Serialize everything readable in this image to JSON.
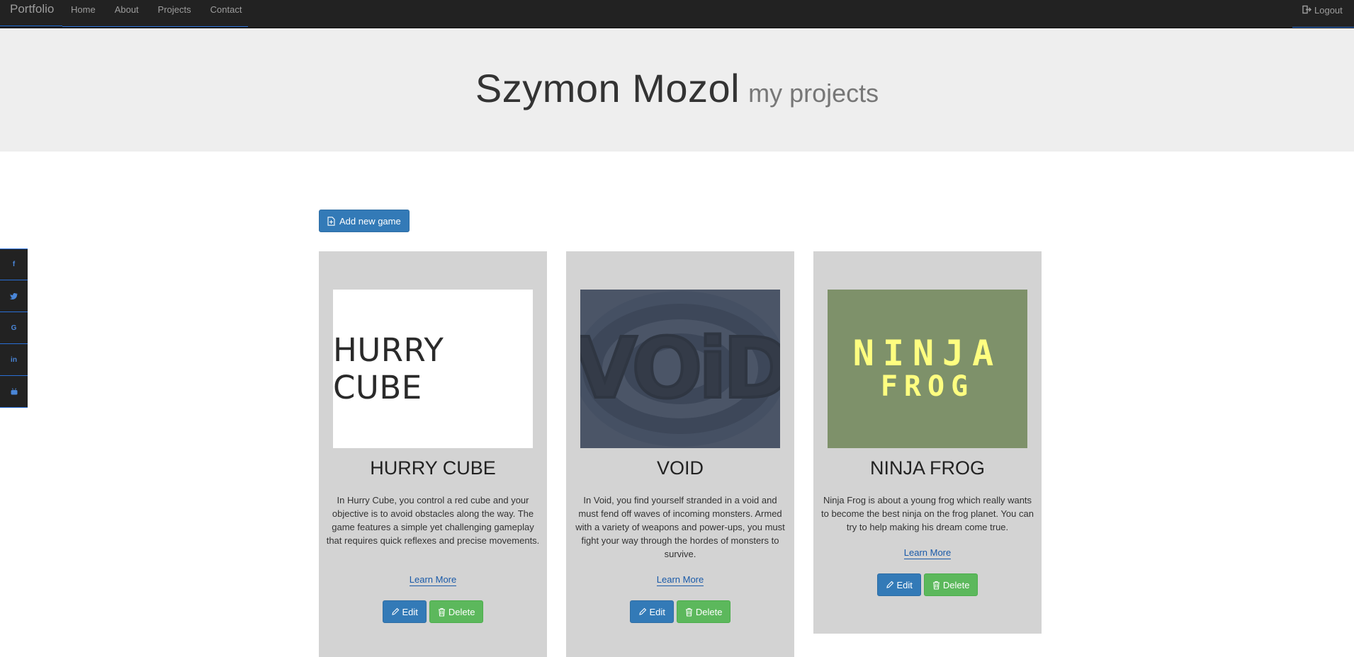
{
  "navbar": {
    "brand": "Portfolio",
    "links": [
      "Home",
      "About",
      "Projects",
      "Contact"
    ],
    "logout_label": "Logout"
  },
  "hero": {
    "name": "Szymon Mozol",
    "subtitle": "my projects"
  },
  "social": {
    "items": [
      {
        "icon": "facebook-icon",
        "glyph": "f"
      },
      {
        "icon": "twitter-icon",
        "glyph": "t"
      },
      {
        "icon": "google-icon",
        "glyph": "G"
      },
      {
        "icon": "linkedin-icon",
        "glyph": "in"
      },
      {
        "icon": "youtube-icon",
        "glyph": "▶"
      }
    ]
  },
  "actions": {
    "add_label": "Add new game"
  },
  "games": [
    {
      "image_text": "HURRY CUBE",
      "title": "HURRY CUBE",
      "description": "In Hurry Cube, you control a red cube and your objective is to avoid obstacles along the way. The game features a simple yet challenging gameplay that requires quick reflexes and precise movements.",
      "learn_more": "Learn More",
      "edit_label": "Edit",
      "delete_label": "Delete"
    },
    {
      "image_text": "VOiD",
      "title": "VOID",
      "description": "In Void, you find yourself stranded in a void and must fend off waves of incoming monsters. Armed with a variety of weapons and power-ups, you must fight your way through the hordes of monsters to survive.",
      "learn_more": "Learn More",
      "edit_label": "Edit",
      "delete_label": "Delete"
    },
    {
      "image_text_line1": "NINJA",
      "image_text_line2": "FROG",
      "title": "NINJA FROG",
      "description": "Ninja Frog is about a young frog which really wants to become the best ninja on the frog planet. You can try to help making his dream come true.",
      "learn_more": "Learn More",
      "edit_label": "Edit",
      "delete_label": "Delete"
    }
  ],
  "colors": {
    "navbar_bg": "#222222",
    "hero_bg": "#eeeeee",
    "card_bg": "#d3d3d3",
    "primary": "#337ab7",
    "success": "#5cb85c",
    "accent_line": "#2a6fd6",
    "ninja_yellow": "#fefe80",
    "ninja_green": "#7e916a",
    "void_slate": "#4b5567"
  }
}
